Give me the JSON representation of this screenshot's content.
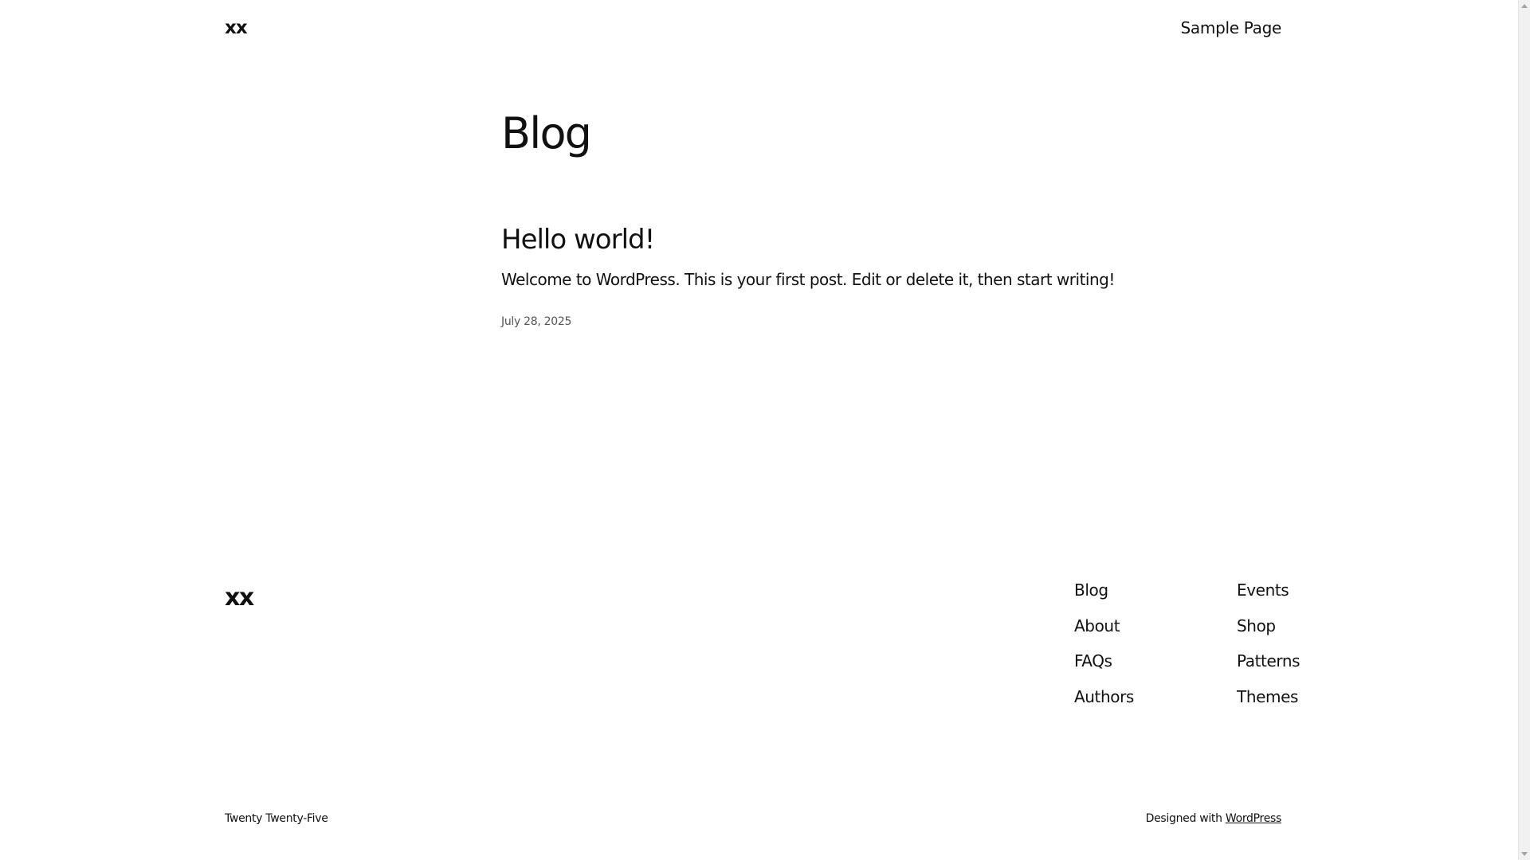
{
  "header": {
    "site_title": "xx",
    "nav": [
      "Sample Page"
    ]
  },
  "main": {
    "heading": "Blog",
    "posts": [
      {
        "title": "Hello world!",
        "excerpt": "Welcome to WordPress. This is your first post. Edit or delete it, then start writing!",
        "date": "July 28, 2025"
      }
    ]
  },
  "footer": {
    "site_title": "xx",
    "nav_col_1": [
      "Blog",
      "About",
      "FAQs",
      "Authors"
    ],
    "nav_col_2": [
      "Events",
      "Shop",
      "Patterns",
      "Themes"
    ],
    "credit_left": "Twenty Twenty-Five",
    "credit_prefix": "Designed with",
    "credit_link": "WordPress"
  },
  "colors": {
    "background": "#ffffff",
    "text": "#111111",
    "meta_text": "#555555"
  },
  "icons": {
    "scroll_up": "chevron-up-icon",
    "scroll_down": "chevron-down-icon"
  }
}
